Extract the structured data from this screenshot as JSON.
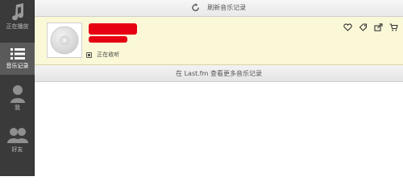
{
  "sidebar": {
    "items": [
      {
        "label": "正在播放",
        "icon": "music-note-icon",
        "active": false
      },
      {
        "label": "音乐记录",
        "icon": "list-icon",
        "active": true
      },
      {
        "label": "我",
        "icon": "user-icon",
        "active": false
      },
      {
        "label": "好友",
        "icon": "friends-icon",
        "active": false
      }
    ]
  },
  "header": {
    "refresh_label": "刷新音乐记录",
    "refresh_icon": "refresh-icon"
  },
  "track": {
    "title": "",
    "artist": "",
    "status": "正在收听",
    "cover_icon": "cd-disc-icon",
    "actions": [
      "love-heart-icon",
      "tag-icon",
      "share-icon",
      "buy-cart-icon"
    ],
    "highlight_color": "#fbf8d8",
    "redaction_color": "#e60012"
  },
  "more": {
    "label": "在 Last.fm 查看更多音乐记录"
  }
}
